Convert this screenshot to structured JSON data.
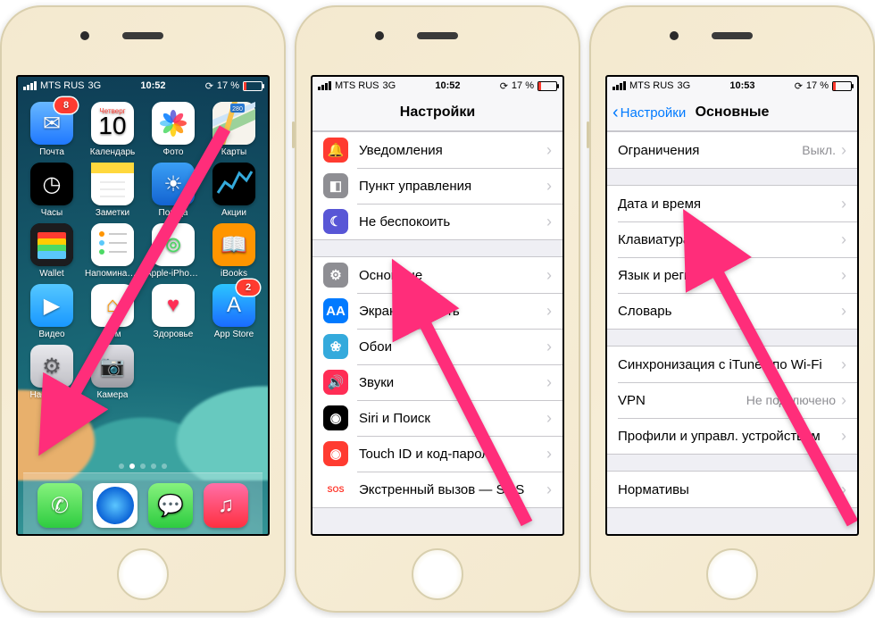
{
  "status": {
    "carrier": "MTS RUS",
    "network": "3G",
    "battery_pct": "17 %"
  },
  "phone1": {
    "time": "10:52",
    "calendar": {
      "dow": "Четверг",
      "day": "10"
    },
    "apps": [
      {
        "name": "mail",
        "label": "Почта",
        "bg": "linear-gradient(#68b8ff,#1f78ff)",
        "glyph": "✉︎",
        "badge": "8"
      },
      {
        "name": "calendar",
        "label": "Календарь",
        "bg": "#fff",
        "glyph": "cal"
      },
      {
        "name": "photos",
        "label": "Фото",
        "bg": "#fff",
        "glyph": "photos"
      },
      {
        "name": "maps",
        "label": "Карты",
        "bg": "#fff",
        "glyph": "maps"
      },
      {
        "name": "clock",
        "label": "Часы",
        "bg": "#000",
        "glyph": "◷"
      },
      {
        "name": "notes",
        "label": "Заметки",
        "bg": "linear-gradient(#fff,#fff6d8)",
        "glyph": "notes"
      },
      {
        "name": "weather",
        "label": "Погода",
        "bg": "linear-gradient(#3a9ff5,#1363d1)",
        "glyph": "☀︎"
      },
      {
        "name": "stocks",
        "label": "Акции",
        "bg": "#000",
        "glyph": "stocks"
      },
      {
        "name": "wallet",
        "label": "Wallet",
        "bg": "#000",
        "glyph": "wallet"
      },
      {
        "name": "reminders",
        "label": "Напоминания",
        "bg": "#fff",
        "glyph": "rem"
      },
      {
        "name": "find-iphone",
        "label": "Apple-iPhon…",
        "bg": "#fff",
        "glyph": "⊚"
      },
      {
        "name": "ibooks",
        "label": "iBooks",
        "bg": "#ff9500",
        "glyph": "📖"
      },
      {
        "name": "videos",
        "label": "Видео",
        "bg": "linear-gradient(#55c8ff,#1998ff)",
        "glyph": "▶"
      },
      {
        "name": "home",
        "label": "Дом",
        "bg": "#fff",
        "glyph": "⌂"
      },
      {
        "name": "health",
        "label": "Здоровье",
        "bg": "#fff",
        "glyph": "♥"
      },
      {
        "name": "appstore",
        "label": "App Store",
        "bg": "linear-gradient(#2cc5ff,#1a6bff)",
        "glyph": "A",
        "badge": "2"
      },
      {
        "name": "settings",
        "label": "Настройки",
        "bg": "linear-gradient(#e9e9ed,#bfbfc5)",
        "glyph": "⚙"
      },
      {
        "name": "camera",
        "label": "Камера",
        "bg": "linear-gradient(#e0e0e6,#9b9ba2)",
        "glyph": "📷"
      }
    ],
    "dock": [
      {
        "name": "phone",
        "bg": "linear-gradient(#86f27d,#2ecc40)",
        "glyph": "✆"
      },
      {
        "name": "safari",
        "bg": "#fff",
        "glyph": "safari"
      },
      {
        "name": "messages",
        "bg": "linear-gradient(#86f27d,#2ecc40)",
        "glyph": "💬"
      },
      {
        "name": "music",
        "bg": "linear-gradient(#ff6fa7,#ff3040)",
        "glyph": "♫"
      }
    ]
  },
  "phone2": {
    "time": "10:52",
    "title": "Настройки",
    "groups": [
      [
        {
          "name": "notifications",
          "label": "Уведомления",
          "icon": "🔔",
          "bg": "#ff3b30"
        },
        {
          "name": "control-center",
          "label": "Пункт управления",
          "icon": "◧",
          "bg": "#8e8e93"
        },
        {
          "name": "dnd",
          "label": "Не беспокоить",
          "icon": "☾",
          "bg": "#5856d6"
        }
      ],
      [
        {
          "name": "general",
          "label": "Основные",
          "icon": "⚙",
          "bg": "#8e8e93"
        },
        {
          "name": "display",
          "label": "Экран и яркость",
          "icon": "AA",
          "bg": "#007aff"
        },
        {
          "name": "wallpaper",
          "label": "Обои",
          "icon": "❀",
          "bg": "#34aadc"
        },
        {
          "name": "sounds",
          "label": "Звуки",
          "icon": "🔊",
          "bg": "#ff2d55"
        },
        {
          "name": "siri",
          "label": "Siri и Поиск",
          "icon": "◉",
          "bg": "#000"
        },
        {
          "name": "touchid",
          "label": "Touch ID и код-пароль",
          "icon": "◉",
          "bg": "#ff3b30"
        },
        {
          "name": "sos",
          "label": "Экстренный вызов — SOS",
          "icon": "SOS",
          "bg": "#fff",
          "fg": "#ff3b30"
        }
      ]
    ]
  },
  "phone3": {
    "time": "10:53",
    "back": "Настройки",
    "title": "Основные",
    "groups": [
      [
        {
          "name": "restrictions",
          "label": "Ограничения",
          "value": "Выкл."
        }
      ],
      [
        {
          "name": "datetime",
          "label": "Дата и время"
        },
        {
          "name": "keyboard",
          "label": "Клавиатура"
        },
        {
          "name": "language",
          "label": "Язык и регион"
        },
        {
          "name": "dictionary",
          "label": "Словарь"
        }
      ],
      [
        {
          "name": "itunes-wifi",
          "label": "Синхронизация с iTunes по Wi-Fi"
        },
        {
          "name": "vpn",
          "label": "VPN",
          "value": "Не подключено"
        },
        {
          "name": "profiles",
          "label": "Профили и управл. устройством"
        }
      ],
      [
        {
          "name": "regulatory",
          "label": "Нормативы"
        }
      ]
    ]
  }
}
